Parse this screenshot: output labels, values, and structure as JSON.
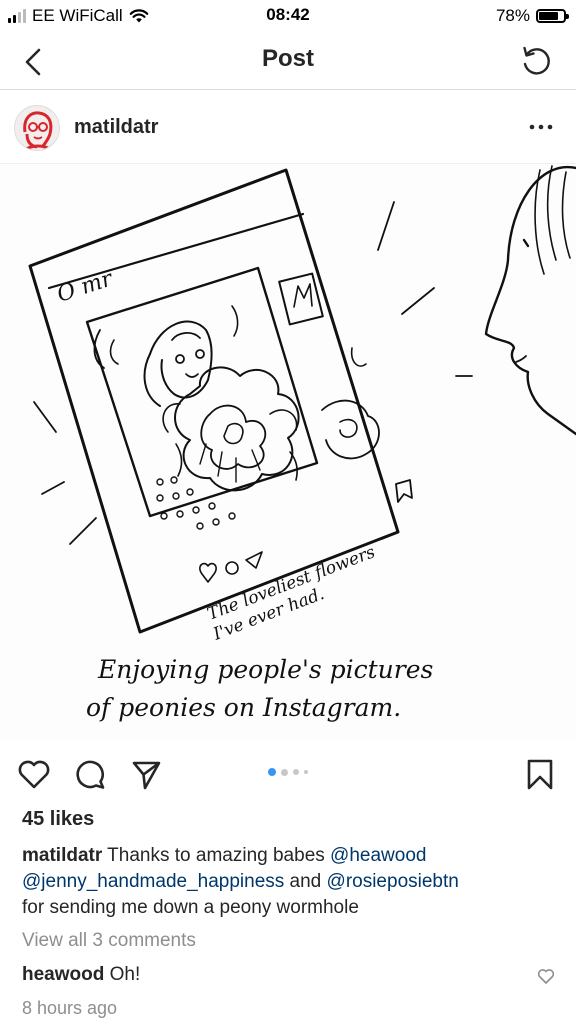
{
  "status_bar": {
    "carrier": "EE WiFiCall",
    "time": "08:42",
    "battery_percent": "78%",
    "battery_level": 0.78,
    "icons": [
      "signal-bars-icon",
      "wifi-icon",
      "battery-icon"
    ]
  },
  "nav": {
    "title": "Post",
    "back_icon": "chevron-left-icon",
    "refresh_icon": "refresh-icon"
  },
  "post": {
    "username": "matildatr",
    "more_icon": "more-horizontal-icon",
    "image": {
      "drawn_text": {
        "phone_header": "O mr",
        "phone_caption_1": "The loveliest flowers",
        "phone_caption_2": "I've ever had.",
        "caption_line_1": "Enjoying people's pictures",
        "caption_line_2": "of peonies on Instagram."
      }
    },
    "carousel": {
      "count": 4,
      "active_index": 0
    },
    "likes": "45 likes",
    "caption": {
      "username": "matildatr",
      "text_1": " Thanks to amazing babes ",
      "mention_1": "@heawood",
      "mention_2": "@jenny_handmade_happiness",
      "text_2": " and ",
      "mention_3": "@rosieposiebtn",
      "text_3": "for sending me down a peony wormhole"
    },
    "view_comments": "View all 3 comments",
    "comment": {
      "username": "heawood",
      "text": " Oh!"
    },
    "timestamp": "8 hours ago"
  },
  "colors": {
    "text": "#262626",
    "secondary": "#8e8e8e",
    "mention": "#00376b",
    "active_dot": "#3897f0",
    "divider": "#dbdbdb"
  }
}
